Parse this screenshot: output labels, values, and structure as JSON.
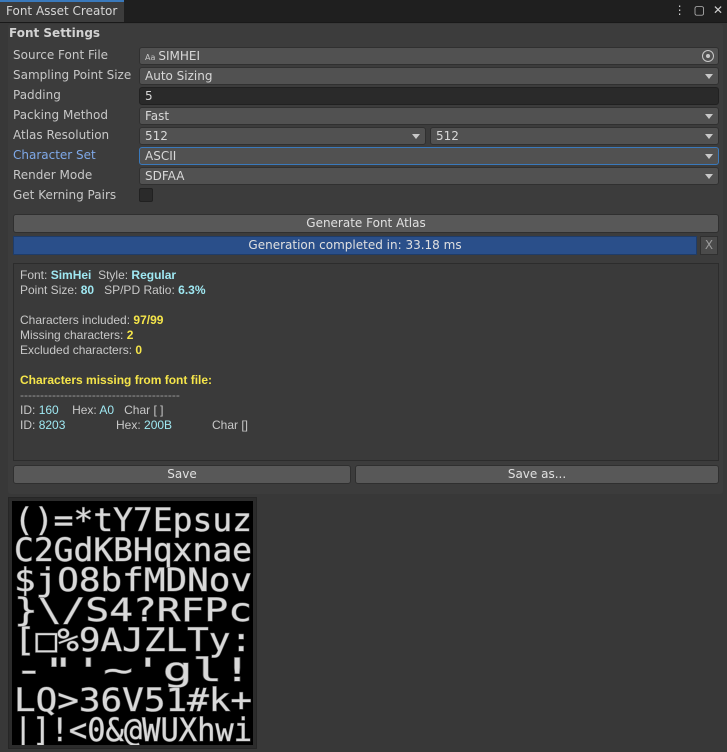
{
  "window": {
    "tab_title": "Font Asset Creator",
    "icons": [
      "more-icon",
      "maximize-icon",
      "close-icon"
    ],
    "icon_glyphs": {
      "more": "⋮",
      "maximize": "▢",
      "close": "✕"
    }
  },
  "settings": {
    "section_title": "Font Settings",
    "source_font_label": "Source Font File",
    "source_font_badge": "Aa",
    "source_font_value": "SIMHEI",
    "sampling_label": "Sampling Point Size",
    "sampling_value": "Auto Sizing",
    "padding_label": "Padding",
    "padding_value": "5",
    "packing_label": "Packing Method",
    "packing_value": "Fast",
    "atlas_label": "Atlas Resolution",
    "atlas_width": "512",
    "atlas_height": "512",
    "charset_label": "Character Set",
    "charset_value": "ASCII",
    "render_label": "Render Mode",
    "render_value": "SDFAA",
    "kerning_label": "Get Kerning Pairs",
    "kerning_checked": false
  },
  "actions": {
    "generate": "Generate Font Atlas",
    "progress_text": "Generation completed in: 33.18 ms",
    "progress_fraction": 1.0,
    "cancel": "X",
    "save": "Save",
    "save_as": "Save as..."
  },
  "report": {
    "font_label": "Font:",
    "font_value": "SimHei",
    "style_label": "Style:",
    "style_value": "Regular",
    "point_size_label": "Point Size:",
    "point_size_value": "80",
    "ratio_label": "SP/PD Ratio:",
    "ratio_value": "6.3%",
    "included_label": "Characters included:",
    "included_value": "97/99",
    "missing_label": "Missing characters:",
    "missing_value": "2",
    "excluded_label": "Excluded characters:",
    "excluded_value": "0",
    "missing_header": "Characters missing from font file:",
    "separator": "----------------------------------------",
    "missing_rows": [
      {
        "id_label": "ID:",
        "id": "160",
        "hex_label": "Hex:",
        "hex": "A0",
        "char": "Char [ ]"
      },
      {
        "id_label": "ID:",
        "id": "8203",
        "hex_label": "Hex:",
        "hex": "200B",
        "char": "Char []"
      }
    ]
  },
  "atlas_preview": {
    "rows": [
      "()=*tY7Epsuz",
      "C2GdKBHqxnae",
      "$jO8bfMDNov",
      "}\\/S4?RFPc",
      "[□%9AJZLTy:",
      "-\"'~'gl!",
      "LQ>36V51#k+",
      "|]!<0&@WUXhwi"
    ]
  }
}
